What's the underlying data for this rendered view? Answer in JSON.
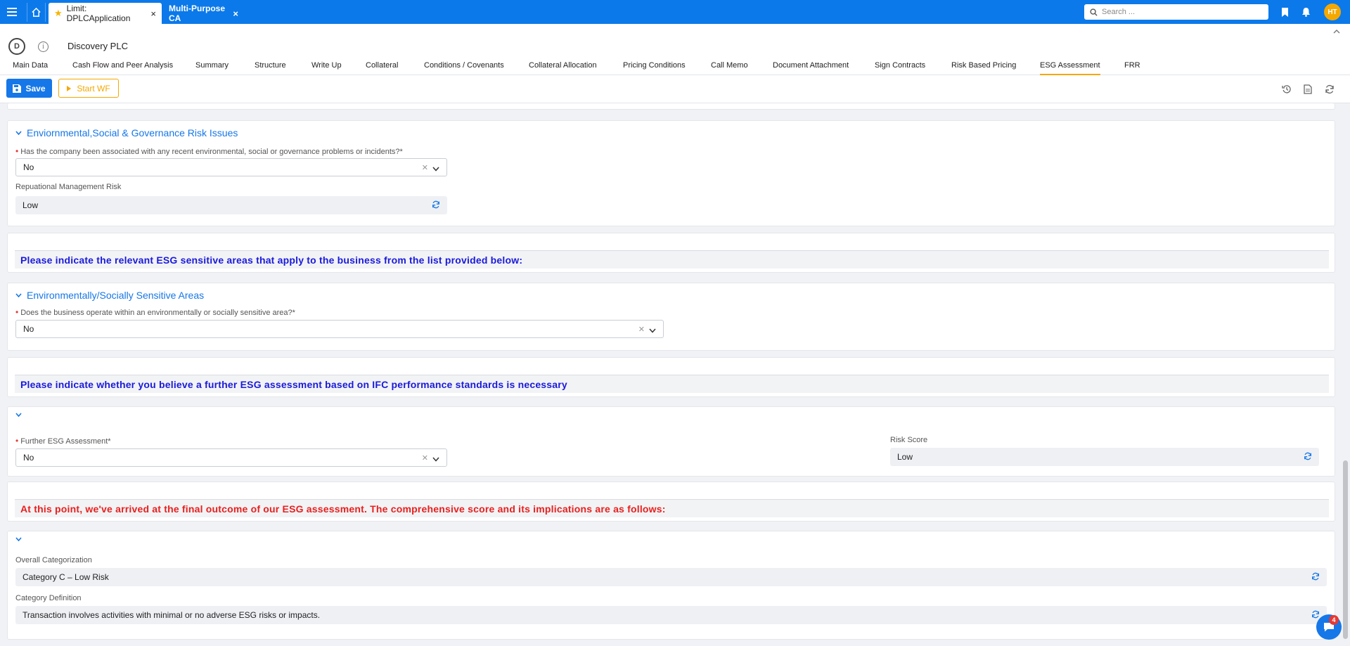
{
  "topbar": {
    "tabs": [
      {
        "label": "Limit: DPLCApplication",
        "close": "×"
      },
      {
        "label": "Multi-Purpose CA",
        "close": "×"
      }
    ],
    "search_placeholder": "Search ...",
    "avatar_initials": "HT"
  },
  "header": {
    "logo_letter": "D",
    "info_glyph": "i",
    "company_name": "Discovery PLC",
    "subtabs": [
      "Main Data",
      "Cash Flow and Peer Analysis",
      "Summary",
      "Structure",
      "Write Up",
      "Collateral",
      "Conditions / Covenants",
      "Collateral Allocation",
      "Pricing Conditions",
      "Call Memo",
      "Document Attachment",
      "Sign Contracts",
      "Risk Based Pricing",
      "ESG Assessment",
      "FRR"
    ],
    "active_subtab": "ESG Assessment"
  },
  "toolbar": {
    "save_label": "Save",
    "start_wf_label": "Start WF"
  },
  "sections": {
    "esg_risk": {
      "title": "Enviornmental,Social & Governance Risk Issues",
      "q1_label": "Has the company been associated with any recent environmental, social or governance problems or incidents?*",
      "q1_value": "No",
      "reputational_label": "Repuational Management Risk",
      "reputational_value": "Low"
    },
    "banner1": "Please indicate the relevant ESG sensitive areas that apply to the business from the list provided below:",
    "sensitive": {
      "title": "Environmentally/Socially Sensitive Areas",
      "q_label": "Does the business operate within an environmentally or socially sensitive area?*",
      "q_value": "No"
    },
    "banner2": "Please indicate whether you believe a further ESG assessment based on IFC performance standards is necessary",
    "further": {
      "label": "Further ESG Assessment*",
      "value": "No",
      "risk_score_label": "Risk Score",
      "risk_score_value": "Low"
    },
    "banner3": "At this point, we've arrived at the final outcome of our ESG assessment. The comprehensive score and its implications are as follows:",
    "outcome": {
      "overall_label": "Overall Categorization",
      "overall_value": "Category C – Low Risk",
      "definition_label": "Category Definition",
      "definition_value": "Transaction involves activities with minimal or no adverse ESG risks or impacts."
    }
  },
  "chat": {
    "badge_count": "4"
  },
  "colors": {
    "primary": "#1677e8",
    "topbar": "#0b79ea",
    "accent": "#f5a800",
    "banner_blue": "#1a1adb",
    "banner_red": "#e8201e",
    "required": "#e53935"
  }
}
